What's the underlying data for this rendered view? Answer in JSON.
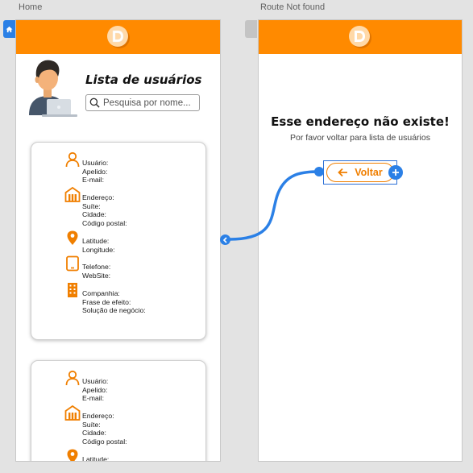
{
  "screens": {
    "home_label": "Home",
    "not_found_label": "Route Not found"
  },
  "colors": {
    "header": "#ff8a00",
    "accent": "#f07f00",
    "link_wire": "#2b80e6"
  },
  "home": {
    "title": "Lista de usuários",
    "search_placeholder": "Pesquisa por nome...",
    "card_labels": {
      "user": [
        "Usuário:",
        "Apelido:",
        "E-mail:"
      ],
      "address": [
        "Endereço:",
        "Suíte:",
        "Cidade:",
        "Código postal:"
      ],
      "geo": [
        "Latitude:",
        "Longitude:"
      ],
      "contact": [
        "Telefone:",
        "WebSite:"
      ],
      "company": [
        "Companhia:",
        "Frase de efeito:",
        "Solução de negócio:"
      ]
    },
    "icons": {
      "user": "person-icon",
      "address": "building-icon",
      "geo": "map-pin-icon",
      "contact": "phone-icon",
      "company": "office-building-icon"
    }
  },
  "not_found": {
    "title": "Esse endereço não existe!",
    "subtitle": "Por favor voltar para lista de usuários",
    "back_button": "Voltar"
  }
}
